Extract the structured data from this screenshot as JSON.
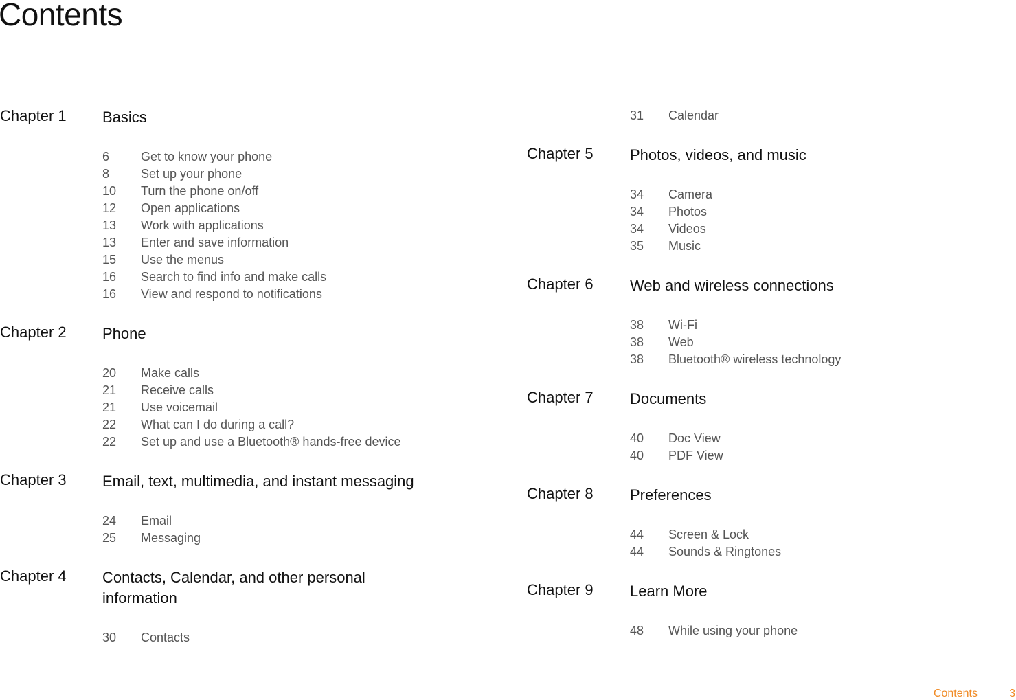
{
  "page_title": "Contents",
  "footer": {
    "section": "Contents",
    "page_number": "3",
    "accent_color": "#f08a24"
  },
  "chapters": [
    {
      "label": "Chapter 1",
      "title": "Basics",
      "entries": [
        {
          "page": "6",
          "text": "Get to know your phone"
        },
        {
          "page": "8",
          "text": "Set up your phone"
        },
        {
          "page": "10",
          "text": "Turn the phone on/off"
        },
        {
          "page": "12",
          "text": "Open applications"
        },
        {
          "page": "13",
          "text": "Work with applications"
        },
        {
          "page": "13",
          "text": "Enter and save information"
        },
        {
          "page": "15",
          "text": "Use the menus"
        },
        {
          "page": "16",
          "text": "Search to find info and make calls"
        },
        {
          "page": "16",
          "text": "View and respond to notifications"
        }
      ]
    },
    {
      "label": "Chapter 2",
      "title": "Phone",
      "entries": [
        {
          "page": "20",
          "text": "Make calls"
        },
        {
          "page": "21",
          "text": "Receive calls"
        },
        {
          "page": "21",
          "text": "Use voicemail"
        },
        {
          "page": "22",
          "text": "What can I do during a call?"
        },
        {
          "page": "22",
          "text": "Set up and use a Bluetooth® hands-free device"
        }
      ]
    },
    {
      "label": "Chapter 3",
      "title": "Email, text, multimedia, and instant messaging",
      "entries": [
        {
          "page": "24",
          "text": "Email"
        },
        {
          "page": "25",
          "text": "Messaging"
        }
      ]
    },
    {
      "label": "Chapter 4",
      "title": "Contacts, Calendar, and other personal information",
      "entries": [
        {
          "page": "30",
          "text": "Contacts"
        },
        {
          "page": "31",
          "text": "Calendar"
        }
      ]
    },
    {
      "label": "Chapter 5",
      "title": "Photos, videos, and music",
      "entries": [
        {
          "page": "34",
          "text": "Camera"
        },
        {
          "page": "34",
          "text": "Photos"
        },
        {
          "page": "34",
          "text": "Videos"
        },
        {
          "page": "35",
          "text": "Music"
        }
      ]
    },
    {
      "label": "Chapter 6",
      "title": "Web and wireless connections",
      "entries": [
        {
          "page": "38",
          "text": "Wi-Fi"
        },
        {
          "page": "38",
          "text": "Web"
        },
        {
          "page": "38",
          "text": "Bluetooth® wireless technology"
        }
      ]
    },
    {
      "label": "Chapter 7",
      "title": "Documents",
      "entries": [
        {
          "page": "40",
          "text": "Doc View"
        },
        {
          "page": "40",
          "text": "PDF View"
        }
      ]
    },
    {
      "label": "Chapter 8",
      "title": "Preferences",
      "entries": [
        {
          "page": "44",
          "text": "Screen & Lock"
        },
        {
          "page": "44",
          "text": "Sounds & Ringtones"
        }
      ]
    },
    {
      "label": "Chapter 9",
      "title": "Learn More",
      "entries": [
        {
          "page": "48",
          "text": "While using your phone"
        }
      ]
    }
  ]
}
